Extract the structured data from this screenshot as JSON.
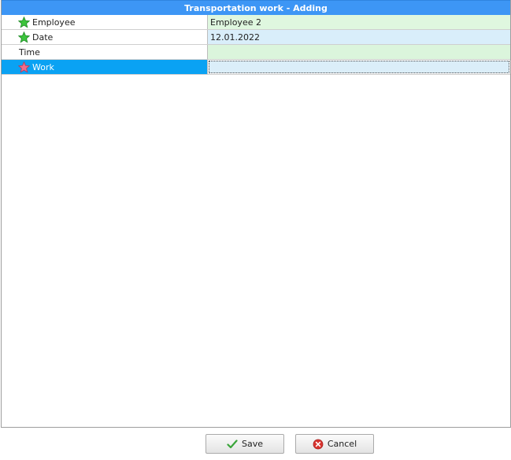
{
  "window": {
    "title": "Transportation work - Adding"
  },
  "fields": [
    {
      "label": "Employee",
      "value": "Employee 2",
      "icon": "green-star-icon"
    },
    {
      "label": "Date",
      "value": "12.01.2022",
      "icon": "green-star-icon"
    },
    {
      "label": "Time",
      "value": "",
      "icon": null
    },
    {
      "label": "Work",
      "value": "",
      "icon": "pink-star-icon"
    }
  ],
  "buttons": {
    "save_label": "Save",
    "cancel_label": "Cancel"
  },
  "colors": {
    "title_bar": "#3d96f5",
    "selected_row": "#0aa2f3",
    "required_star": "#3cc43c",
    "pending_star": "#f06c8c"
  }
}
